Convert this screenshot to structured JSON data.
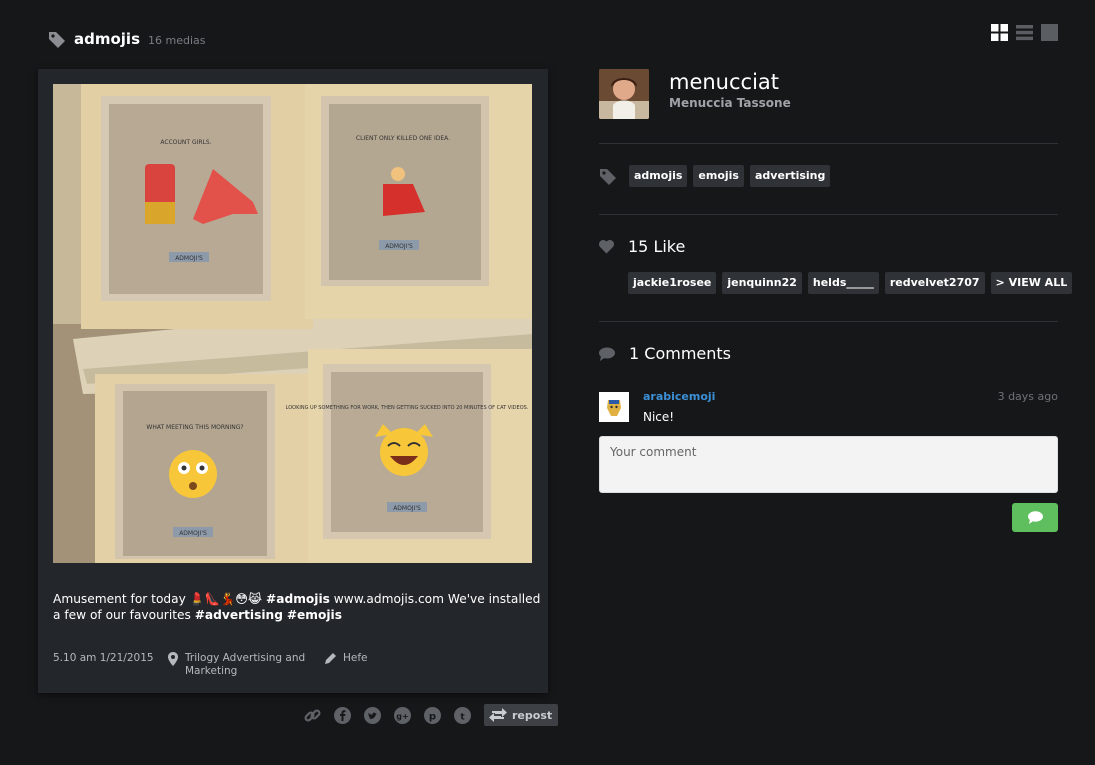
{
  "header": {
    "title": "admojis",
    "count": "16 medias"
  },
  "post": {
    "caption_start": "Amusement for today ",
    "caption_emojis": "💄👠💃😳😹",
    "hashtag1": "#admojis",
    "caption_mid": " www.admojis.com We've installed a few of our favourites ",
    "hashtag2": "#advertising",
    "hashtag3": "#emojis",
    "date": "5.10 am 1/21/2015",
    "location_line1": "Trilogy Advertising and",
    "location_line2": "Marketing",
    "filter": "Hefe",
    "frames": [
      {
        "text": "ACCOUNT GIRLS.",
        "badge": "ADMOJI'S"
      },
      {
        "text": "CLIENT ONLY KILLED ONE IDEA.",
        "badge": "ADMOJI'S"
      },
      {
        "text": "WHAT MEETING THIS MORNING?",
        "badge": "ADMOJI'S"
      },
      {
        "text": "LOOKING UP SOMETHING FOR WORK, THEN GETTING SUCKED INTO 20 MINUTES OF CAT VIDEOS.",
        "badge": "ADMOJI'S"
      }
    ]
  },
  "share": {
    "repost_label": "repost"
  },
  "user": {
    "username": "menucciat",
    "fullname": "Menuccia Tassone"
  },
  "tags": [
    "admojis",
    "emojis",
    "advertising"
  ],
  "likes": {
    "title": "15 Like",
    "users": [
      "jackie1rosee",
      "jenquinn22",
      "helds_____",
      "redvelvet2707"
    ],
    "view_all": "> VIEW ALL"
  },
  "comments": {
    "title": "1 Comments",
    "items": [
      {
        "user": "arabicemoji",
        "time": "3 days ago",
        "text": "Nice!"
      }
    ],
    "placeholder": "Your comment"
  },
  "colors": {
    "background": "#151719",
    "card": "#23272c",
    "accent_link": "#3d8fd6",
    "send_button": "#5fbe5e"
  }
}
